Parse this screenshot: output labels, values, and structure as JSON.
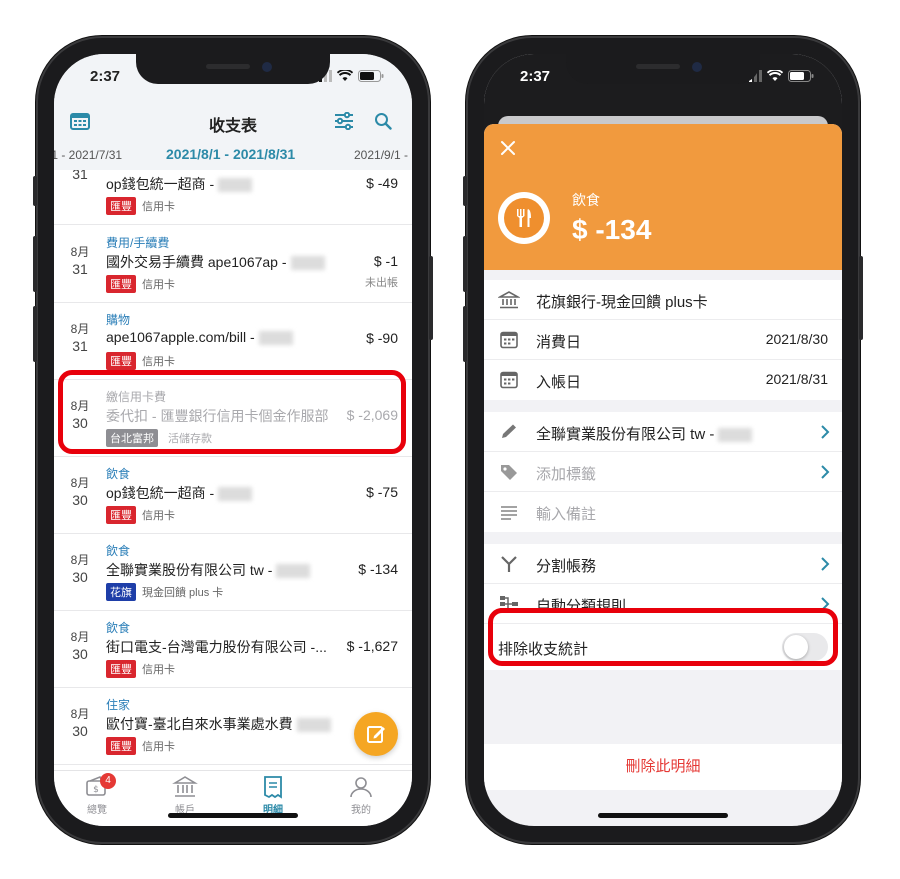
{
  "status": {
    "time": "2:37"
  },
  "left": {
    "header": {
      "title": "收支表"
    },
    "date_range": {
      "prev": "/1 - 2021/7/31",
      "current": "2021/8/1 - 2021/8/31",
      "next": "2021/9/1 -"
    },
    "rows": [
      {
        "month": "",
        "day": "31",
        "category": "",
        "desc": "op錢包統一超商 -",
        "amount": "$ -49",
        "badge": "匯豐",
        "account": "信用卡",
        "note": ""
      },
      {
        "month": "8月",
        "day": "31",
        "category": "費用/手續費",
        "desc": "國外交易手續費 ape1067ap -",
        "amount": "$ -1",
        "badge": "匯豐",
        "account": "信用卡",
        "note": "未出帳"
      },
      {
        "month": "8月",
        "day": "31",
        "category": "購物",
        "desc": "ape1067apple.com/bill -",
        "amount": "$ -90",
        "badge": "匯豐",
        "account": "信用卡",
        "note": ""
      },
      {
        "month": "8月",
        "day": "30",
        "category": "繳信用卡費",
        "desc": "委代扣 - 匯豐銀行信用卡個金作服部",
        "amount": "$ -2,069",
        "badge": "台北富邦",
        "account": "活儲存款",
        "note": ""
      },
      {
        "month": "8月",
        "day": "30",
        "category": "飲食",
        "desc": "op錢包統一超商 -",
        "amount": "$ -75",
        "badge": "匯豐",
        "account": "信用卡",
        "note": ""
      },
      {
        "month": "8月",
        "day": "30",
        "category": "飲食",
        "desc": "全聯實業股份有限公司 tw -",
        "amount": "$ -134",
        "badge": "花旗",
        "account": "現金回饋 plus 卡",
        "note": ""
      },
      {
        "month": "8月",
        "day": "30",
        "category": "飲食",
        "desc": "街口電支-台灣電力股份有限公司 -...",
        "amount": "$ -1,627",
        "badge": "匯豐",
        "account": "信用卡",
        "note": ""
      },
      {
        "month": "8月",
        "day": "30",
        "category": "住家",
        "desc": "歐付寶-臺北自來水事業處水費",
        "amount": "",
        "badge": "匯豐",
        "account": "信用卡",
        "note": ""
      }
    ],
    "tabs": [
      {
        "label": "總覽",
        "badge": "4"
      },
      {
        "label": "帳戶",
        "badge": ""
      },
      {
        "label": "明細",
        "badge": ""
      },
      {
        "label": "我的",
        "badge": ""
      }
    ],
    "colors": {
      "accent": "#2c8aa8",
      "hsbc": "#d9262e",
      "citi": "#1e3ea8",
      "fab": "#f5a623",
      "highlight": "#e8000b"
    }
  },
  "right": {
    "header": {
      "category": "飲食",
      "amount": "$ -134",
      "color": "#f19a3e"
    },
    "account": "花旗銀行-現金回饋 plus卡",
    "spend_date": {
      "label": "消費日",
      "value": "2021/8/30"
    },
    "post_date": {
      "label": "入帳日",
      "value": "2021/8/31"
    },
    "merchant": "全聯實業股份有限公司 tw -",
    "tag_placeholder": "添加標籤",
    "note_placeholder": "輸入備註",
    "split": "分割帳務",
    "auto_rule": "自動分類規則",
    "exclude": {
      "label": "排除收支統計",
      "enabled": false
    },
    "delete": "刪除此明細"
  }
}
